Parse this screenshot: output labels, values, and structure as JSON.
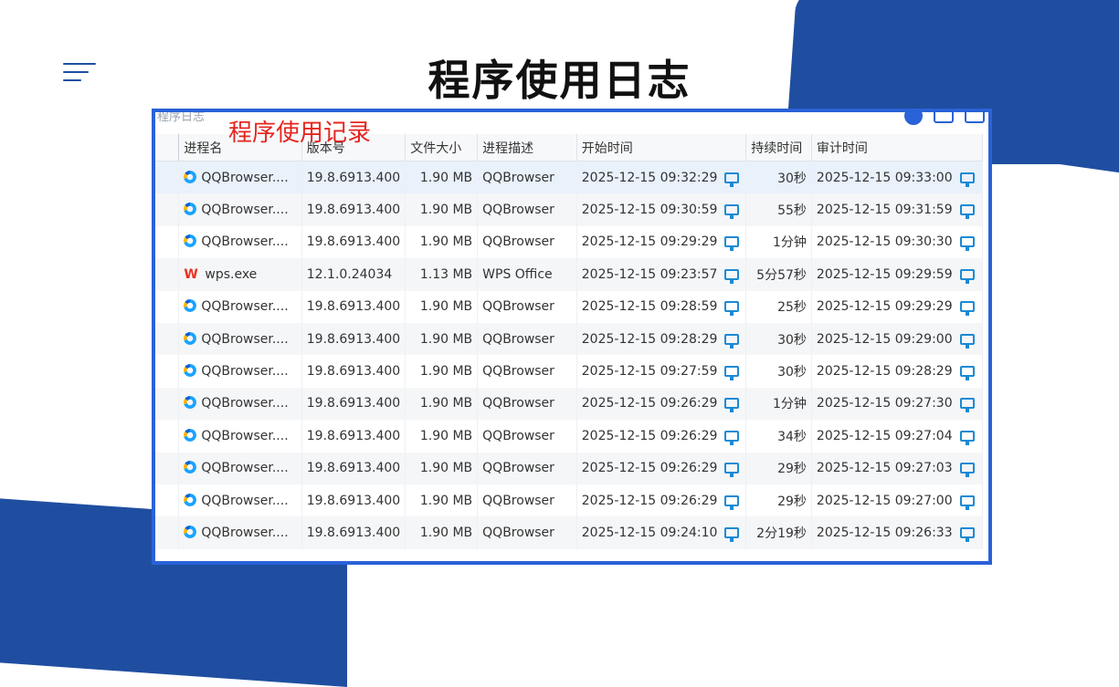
{
  "page": {
    "title": "程序使用日志",
    "overlay_label": "程序使用记录",
    "window_title_fragment": "程序日志"
  },
  "table": {
    "columns": [
      "",
      "进程名",
      "版本号",
      "文件大小",
      "进程描述",
      "开始时间",
      "持续时间",
      "审计时间"
    ],
    "rows": [
      {
        "icon": "qqbrowser-icon",
        "name": "QQBrowser....",
        "version": "19.8.6913.400",
        "size": "1.90 MB",
        "desc": "QQBrowser",
        "start": "2025-12-15 09:32:29",
        "duration": "30秒",
        "audit": "2025-12-15 09:33:00"
      },
      {
        "icon": "qqbrowser-icon",
        "name": "QQBrowser....",
        "version": "19.8.6913.400",
        "size": "1.90 MB",
        "desc": "QQBrowser",
        "start": "2025-12-15 09:30:59",
        "duration": "55秒",
        "audit": "2025-12-15 09:31:59"
      },
      {
        "icon": "qqbrowser-icon",
        "name": "QQBrowser....",
        "version": "19.8.6913.400",
        "size": "1.90 MB",
        "desc": "QQBrowser",
        "start": "2025-12-15 09:29:29",
        "duration": "1分钟",
        "audit": "2025-12-15 09:30:30"
      },
      {
        "icon": "wps-icon",
        "name": "wps.exe",
        "version": "12.1.0.24034",
        "size": "1.13 MB",
        "desc": "WPS Office",
        "start": "2025-12-15 09:23:57",
        "duration": "5分57秒",
        "audit": "2025-12-15 09:29:59"
      },
      {
        "icon": "qqbrowser-icon",
        "name": "QQBrowser....",
        "version": "19.8.6913.400",
        "size": "1.90 MB",
        "desc": "QQBrowser",
        "start": "2025-12-15 09:28:59",
        "duration": "25秒",
        "audit": "2025-12-15 09:29:29"
      },
      {
        "icon": "qqbrowser-icon",
        "name": "QQBrowser....",
        "version": "19.8.6913.400",
        "size": "1.90 MB",
        "desc": "QQBrowser",
        "start": "2025-12-15 09:28:29",
        "duration": "30秒",
        "audit": "2025-12-15 09:29:00"
      },
      {
        "icon": "qqbrowser-icon",
        "name": "QQBrowser....",
        "version": "19.8.6913.400",
        "size": "1.90 MB",
        "desc": "QQBrowser",
        "start": "2025-12-15 09:27:59",
        "duration": "30秒",
        "audit": "2025-12-15 09:28:29"
      },
      {
        "icon": "qqbrowser-icon",
        "name": "QQBrowser....",
        "version": "19.8.6913.400",
        "size": "1.90 MB",
        "desc": "QQBrowser",
        "start": "2025-12-15 09:26:29",
        "duration": "1分钟",
        "audit": "2025-12-15 09:27:30"
      },
      {
        "icon": "qqbrowser-icon",
        "name": "QQBrowser....",
        "version": "19.8.6913.400",
        "size": "1.90 MB",
        "desc": "QQBrowser",
        "start": "2025-12-15 09:26:29",
        "duration": "34秒",
        "audit": "2025-12-15 09:27:04"
      },
      {
        "icon": "qqbrowser-icon",
        "name": "QQBrowser....",
        "version": "19.8.6913.400",
        "size": "1.90 MB",
        "desc": "QQBrowser",
        "start": "2025-12-15 09:26:29",
        "duration": "29秒",
        "audit": "2025-12-15 09:27:03"
      },
      {
        "icon": "qqbrowser-icon",
        "name": "QQBrowser....",
        "version": "19.8.6913.400",
        "size": "1.90 MB",
        "desc": "QQBrowser",
        "start": "2025-12-15 09:26:29",
        "duration": "29秒",
        "audit": "2025-12-15 09:27:00"
      },
      {
        "icon": "qqbrowser-icon",
        "name": "QQBrowser....",
        "version": "19.8.6913.400",
        "size": "1.90 MB",
        "desc": "QQBrowser",
        "start": "2025-12-15 09:24:10",
        "duration": "2分19秒",
        "audit": "2025-12-15 09:26:33"
      }
    ]
  },
  "colors": {
    "accent_blue": "#1f4ea1",
    "frame_blue": "#2a62d8",
    "overlay_red": "#e5251f",
    "monitor_icon": "#1a8ad4"
  }
}
